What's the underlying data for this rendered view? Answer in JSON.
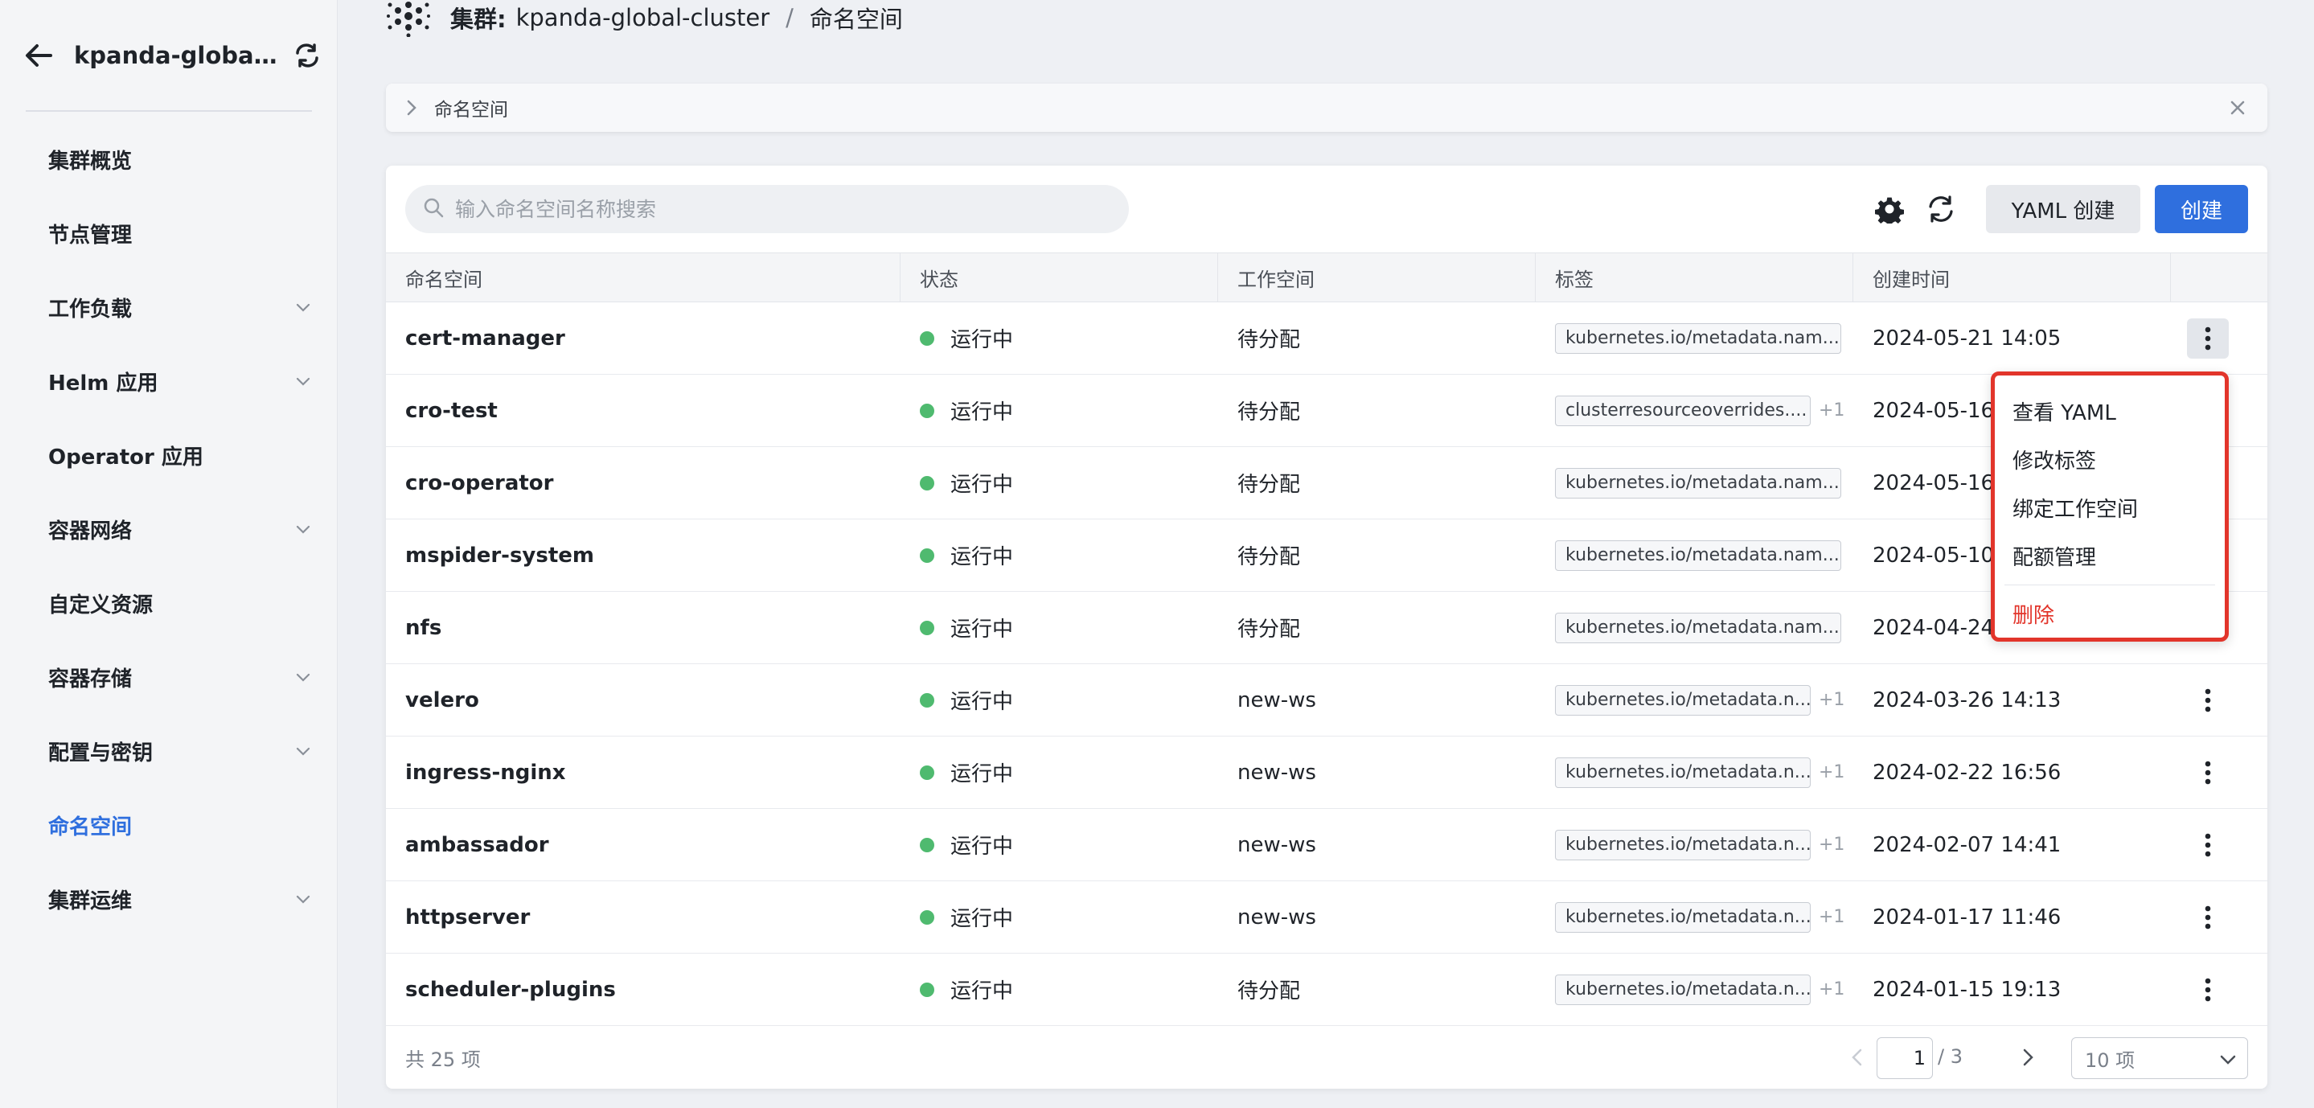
{
  "sidebar": {
    "cluster_name": "kpanda-global-cl...",
    "items": [
      {
        "label": "集群概览",
        "expandable": false,
        "active": false
      },
      {
        "label": "节点管理",
        "expandable": false,
        "active": false
      },
      {
        "label": "工作负载",
        "expandable": true,
        "active": false
      },
      {
        "label": "Helm 应用",
        "expandable": true,
        "active": false
      },
      {
        "label": "Operator 应用",
        "expandable": false,
        "active": false
      },
      {
        "label": "容器网络",
        "expandable": true,
        "active": false
      },
      {
        "label": "自定义资源",
        "expandable": false,
        "active": false
      },
      {
        "label": "容器存储",
        "expandable": true,
        "active": false
      },
      {
        "label": "配置与密钥",
        "expandable": true,
        "active": false
      },
      {
        "label": "命名空间",
        "expandable": false,
        "active": true
      },
      {
        "label": "集群运维",
        "expandable": true,
        "active": false
      }
    ]
  },
  "breadcrumb": {
    "label": "集群:",
    "cluster": "kpanda-global-cluster",
    "separator": "/",
    "page": "命名空间"
  },
  "info_panel": {
    "title": "命名空间"
  },
  "toolbar": {
    "search_placeholder": "输入命名空间名称搜索",
    "yaml_create_label": "YAML 创建",
    "create_label": "创建"
  },
  "table": {
    "columns": [
      "命名空间",
      "状态",
      "工作空间",
      "标签",
      "创建时间",
      ""
    ],
    "rows": [
      {
        "name": "cert-manager",
        "status": "运行中",
        "workspace": "待分配",
        "tag": "kubernetes.io/metadata.nam...",
        "extra": "",
        "created": "2024-05-21 14:05"
      },
      {
        "name": "cro-test",
        "status": "运行中",
        "workspace": "待分配",
        "tag": "clusterresourceoverrides....",
        "extra": "+1",
        "created": "2024-05-16"
      },
      {
        "name": "cro-operator",
        "status": "运行中",
        "workspace": "待分配",
        "tag": "kubernetes.io/metadata.nam...",
        "extra": "",
        "created": "2024-05-16"
      },
      {
        "name": "mspider-system",
        "status": "运行中",
        "workspace": "待分配",
        "tag": "kubernetes.io/metadata.nam...",
        "extra": "",
        "created": "2024-05-10"
      },
      {
        "name": "nfs",
        "status": "运行中",
        "workspace": "待分配",
        "tag": "kubernetes.io/metadata.nam...",
        "extra": "",
        "created": "2024-04-24"
      },
      {
        "name": "velero",
        "status": "运行中",
        "workspace": "new-ws",
        "tag": "kubernetes.io/metadata.n...",
        "extra": "+1",
        "created": "2024-03-26 14:13"
      },
      {
        "name": "ingress-nginx",
        "status": "运行中",
        "workspace": "new-ws",
        "tag": "kubernetes.io/metadata.n...",
        "extra": "+1",
        "created": "2024-02-22 16:56"
      },
      {
        "name": "ambassador",
        "status": "运行中",
        "workspace": "new-ws",
        "tag": "kubernetes.io/metadata.n...",
        "extra": "+1",
        "created": "2024-02-07 14:41"
      },
      {
        "name": "httpserver",
        "status": "运行中",
        "workspace": "new-ws",
        "tag": "kubernetes.io/metadata.n...",
        "extra": "+1",
        "created": "2024-01-17 11:46"
      },
      {
        "name": "scheduler-plugins",
        "status": "运行中",
        "workspace": "待分配",
        "tag": "kubernetes.io/metadata.n...",
        "extra": "+1",
        "created": "2024-01-15 19:13"
      }
    ]
  },
  "context_menu": {
    "items": [
      "查看 YAML",
      "修改标签",
      "绑定工作空间",
      "配额管理"
    ],
    "danger_item": "删除"
  },
  "footer": {
    "total": "共 25 项",
    "current_page": "1",
    "total_pages": "/ 3",
    "page_size": "10 项"
  },
  "colors": {
    "accent": "#2f6fde",
    "status_running": "#4fba6f",
    "danger": "#e2352b"
  }
}
